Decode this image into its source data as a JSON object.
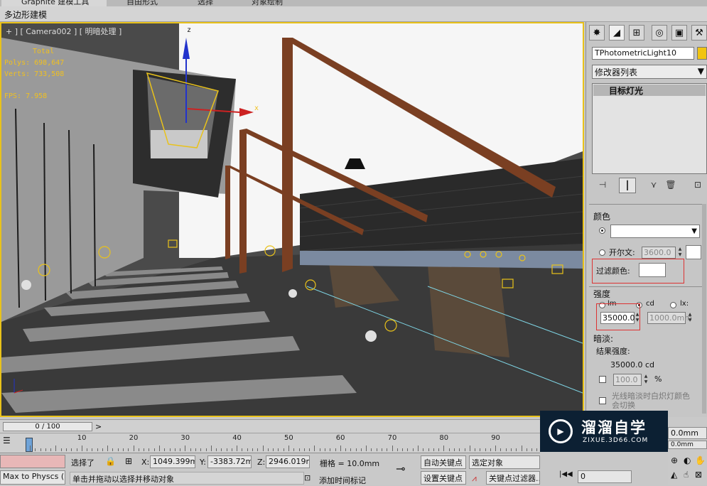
{
  "ribbon": {
    "tabs": [
      "Graphite 建模工具",
      "自由形式",
      "选择",
      "对象绘制"
    ]
  },
  "subbar": {
    "label": "多边形建模"
  },
  "viewport": {
    "label": "+ ] [ Camera002 ] [ 明暗处理 ]",
    "stats": {
      "total_label": "Total",
      "polys": "Polys: 698,647",
      "verts": "Verts: 733,508",
      "fps": "FPS:    7.958"
    },
    "axis_z": "z",
    "axis_x": "x"
  },
  "command_panel": {
    "object_name": "TPhotometricLight10",
    "modifier_list": "修改器列表",
    "stack_item": "目标灯光",
    "color_section": {
      "title": "颜色",
      "kelvin_label": "开尔文:",
      "kelvin_value": "3600.0",
      "filter_label": "过滤颜色:"
    },
    "intensity_section": {
      "title": "强度",
      "unit_lm": "lm",
      "unit_cd": "cd",
      "unit_lx": "lx:",
      "value": "35000.0",
      "lx_value": "1000.0mm"
    },
    "dimming_section": {
      "title": "暗淡:",
      "result_label": "结果强度:",
      "result_value": "35000.0 cd",
      "percent_value": "100.0",
      "percent_sign": "%",
      "incandescent_label": "光线暗淡时白炽灯颜色会切换"
    }
  },
  "timeline": {
    "frame_display": "0 / 100",
    "next_arrow": ">",
    "ticks": [
      "10",
      "20",
      "30",
      "40",
      "50",
      "60",
      "70",
      "80",
      "90"
    ]
  },
  "status": {
    "left_script": "Max to Physcs (",
    "selection": "选择了",
    "x_label": "X:",
    "x_value": "1049.399m",
    "y_label": "Y:",
    "y_value": "-3383.72m",
    "z_label": "Z:",
    "z_value": "2946.019m",
    "grid": "栅格 = 10.0mm",
    "hint": "单击并拖动以选择并移动对象",
    "add_time_tag": "添加时间标记",
    "auto_key": "自动关键点",
    "set_key": "设置关键点",
    "selected_obj": "选定对象",
    "key_filters": "关键点过滤器...",
    "frame_field": "0",
    "right_value1": "0.0mm",
    "right_value2": "0.0mm"
  },
  "watermark": {
    "title": "溜溜自学",
    "url": "ZIXUE.3D66.COM"
  },
  "colors": {
    "accent_yellow": "#e9c21a",
    "stat_yellow": "#f0c020",
    "highlight_red": "#dd3333"
  }
}
